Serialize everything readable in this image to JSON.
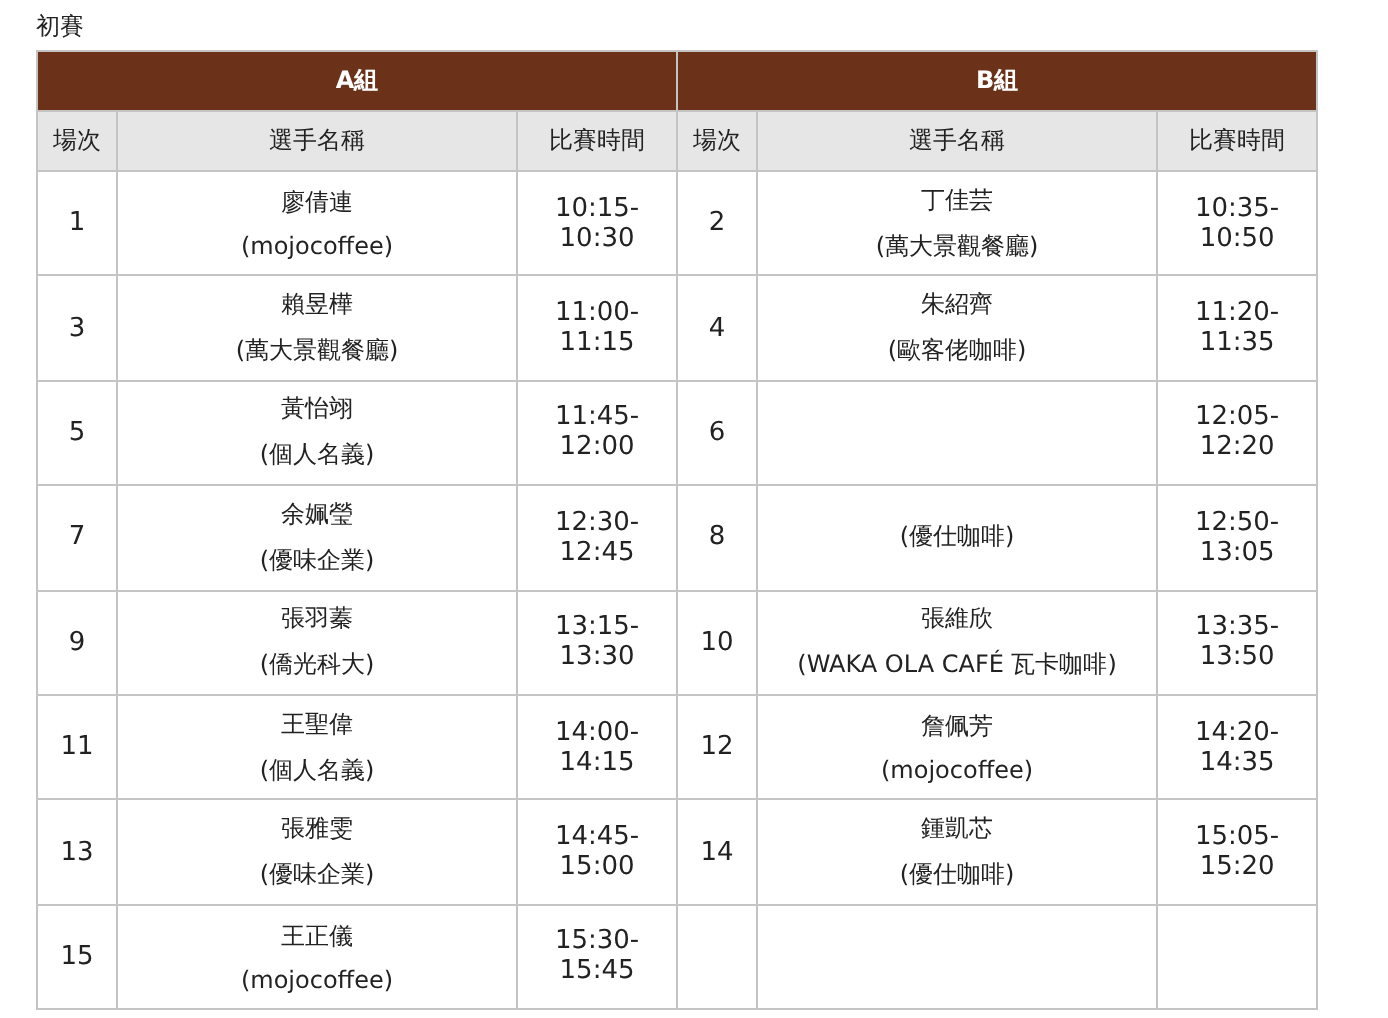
{
  "title": "初賽",
  "groups": [
    {
      "name": "A組",
      "columns": [
        "場次",
        "選手名稱",
        "比賽時間"
      ],
      "rows": [
        {
          "match": "1",
          "player": "廖倩連",
          "team": "(mojocoffee)",
          "time": "10:15-10:30"
        },
        {
          "match": "3",
          "player": "賴昱樺",
          "team": "(萬大景觀餐廳)",
          "time": "11:00-11:15"
        },
        {
          "match": "5",
          "player": "黃怡翊",
          "team": "(個人名義)",
          "time": "11:45-12:00"
        },
        {
          "match": "7",
          "player": "余姵瑩",
          "team": "(優味企業)",
          "time": "12:30-12:45"
        },
        {
          "match": "9",
          "player": "張羽蓁",
          "team": "(僑光科大)",
          "time": "13:15-13:30"
        },
        {
          "match": "11",
          "player": "王聖偉",
          "team": "(個人名義)",
          "time": "14:00-14:15"
        },
        {
          "match": "13",
          "player": "張雅雯",
          "team": "(優味企業)",
          "time": "14:45-15:00"
        },
        {
          "match": "15",
          "player": "王正儀",
          "team": "(mojocoffee)",
          "time": "15:30-15:45"
        }
      ]
    },
    {
      "name": "B組",
      "columns": [
        "場次",
        "選手名稱",
        "比賽時間"
      ],
      "rows": [
        {
          "match": "2",
          "player": "丁佳芸",
          "team": "(萬大景觀餐廳)",
          "time": "10:35-10:50"
        },
        {
          "match": "4",
          "player": "朱紹齊",
          "team": "(歐客佬咖啡)",
          "time": "11:20-11:35"
        },
        {
          "match": "6",
          "time": "12:05-12:20"
        },
        {
          "match": "8",
          "team": "(優仕咖啡)",
          "time": "12:50-13:05"
        },
        {
          "match": "10",
          "player": "張維欣",
          "team": "(WAKA OLA CAFÉ 瓦卡咖啡)",
          "time": "13:35-13:50"
        },
        {
          "match": "12",
          "player": "詹佩芳",
          "team": "(mojocoffee)",
          "time": "14:20-14:35"
        },
        {
          "match": "14",
          "player": "鍾凱芯",
          "team": "(優仕咖啡)",
          "time": "15:05-15:20"
        }
      ]
    }
  ]
}
